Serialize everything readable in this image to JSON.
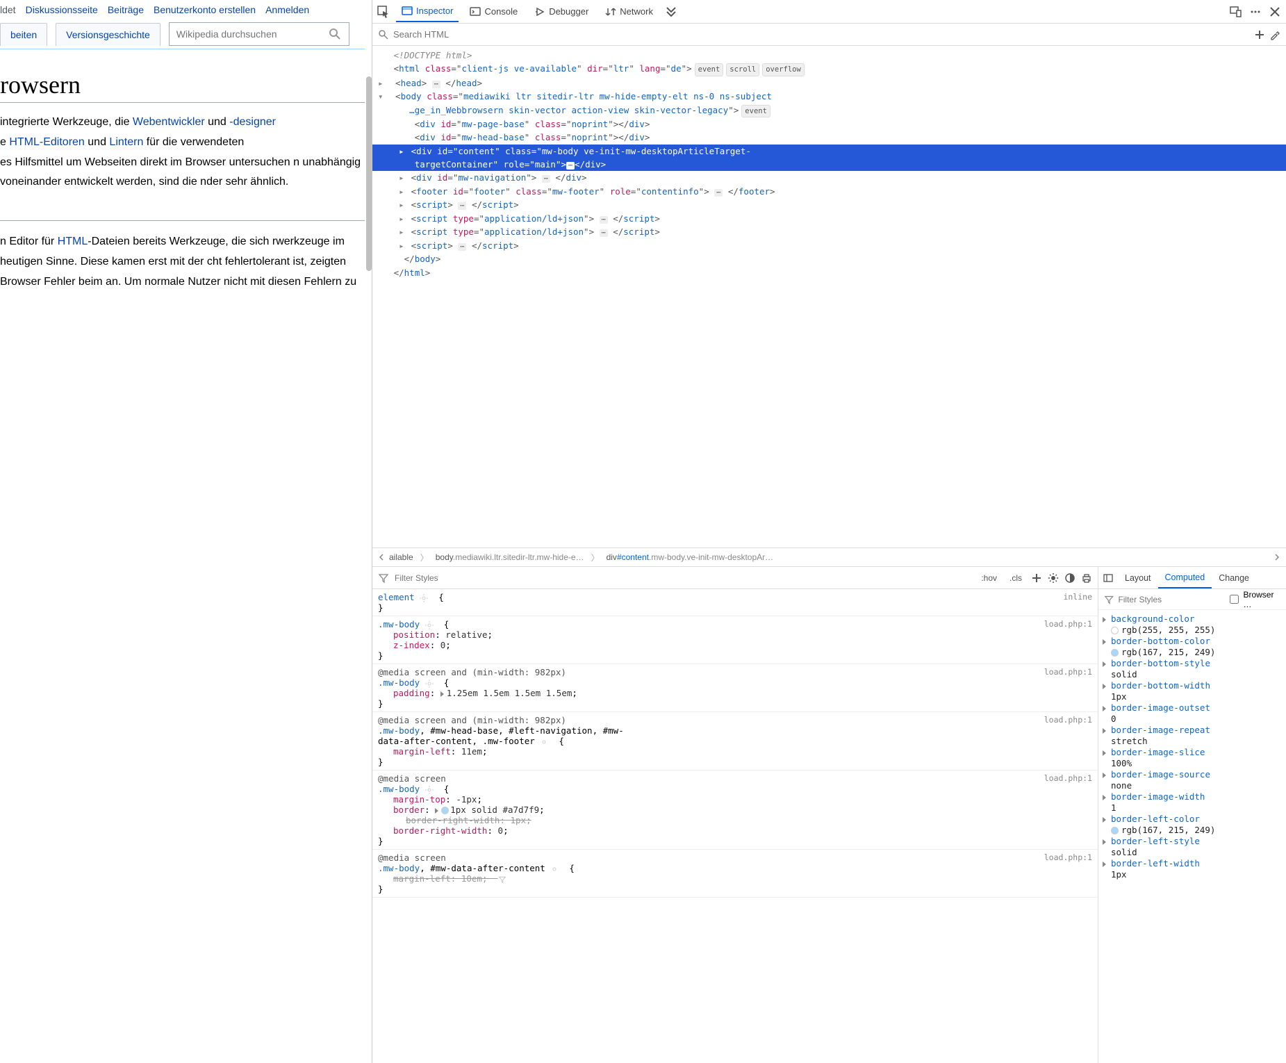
{
  "content": {
    "top_links": [
      "ldet",
      "Diskussionsseite",
      "Beiträge",
      "Benutzerkonto erstellen",
      "Anmelden"
    ],
    "tabs": [
      "beiten",
      "Versionsgeschichte"
    ],
    "search_placeholder": "Wikipedia durchsuchen",
    "heading": "rowsern",
    "para1_pre": " integrierte Werkzeuge, die ",
    "para1_link1": "Webentwickler",
    "para1_mid1": " und ",
    "para1_link2": "-designer",
    "para1_line2a": "e ",
    "para1_link3": "HTML-Editoren",
    "para1_line2b": " und ",
    "para1_link4": "Lintern",
    "para1_line2c": " für die verwendeten",
    "para1_rest": "es Hilfsmittel um Webseiten direkt im Browser untersuchen n unabhängig voneinander entwickelt werden, sind die nder sehr ähnlich.",
    "para2_pre": "n Editor für ",
    "para2_link1": "HTML",
    "para2_rest": "-Dateien bereits Werkzeuge, die sich rwerkzeuge im heutigen Sinne. Diese kamen erst mit der cht fehlertolerant ist, zeigten Browser Fehler beim an. Um normale Nutzer nicht mit diesen Fehlern zu"
  },
  "toolbar": {
    "inspector": "Inspector",
    "console": "Console",
    "debugger": "Debugger",
    "network": "Network"
  },
  "search_html": "Search HTML",
  "dom": {
    "doctype": "<!DOCTYPE html>",
    "html_attrs": "class=\"client-js ve-available\" dir=\"ltr\" lang=\"de\"",
    "html_badges": [
      "event",
      "scroll",
      "overflow"
    ],
    "body_class": "mediawiki ltr sitedir-ltr mw-hide-empty-elt ns-0 ns-subject …ge_in_Webbrowsern skin-vector action-view skin-vector-legacy",
    "body_badge": "event",
    "div_page_base": {
      "id": "mw-page-base",
      "class": "noprint"
    },
    "div_head_base": {
      "id": "mw-head-base",
      "class": "noprint"
    },
    "div_content": {
      "id": "content",
      "class": "mw-body ve-init-mw-desktopArticleTarget-targetContainer",
      "role": "main"
    },
    "div_nav": {
      "id": "mw-navigation"
    },
    "footer": {
      "id": "footer",
      "class": "mw-footer",
      "role": "contentinfo"
    },
    "script_type": "application/ld+json"
  },
  "breadcrumb": {
    "first": "ailable",
    "body": "body",
    "body_cls": ".mediawiki.ltr.sitedir-ltr.mw-hide-e…",
    "div": "div",
    "div_id": "#content",
    "div_cls": ".mw-body.ve-init-mw-desktopAr…"
  },
  "rules": {
    "filter": "Filter Styles",
    "hov": ":hov",
    "cls": ".cls",
    "blocks": [
      {
        "sel": "element",
        "src": "inline",
        "open": "{",
        "decls": [],
        "close": "}"
      },
      {
        "sel": ".mw-body",
        "src": "load.php:1",
        "decls": [
          {
            "p": "position",
            "v": "relative"
          },
          {
            "p": "z-index",
            "v": "0"
          }
        ]
      },
      {
        "media": "@media screen and (min-width: 982px)",
        "src": "load.php:1",
        "sel": ".mw-body",
        "decls": [
          {
            "p": "padding",
            "v": "1.25em 1.5em 1.5em 1.5em",
            "tw": true
          }
        ]
      },
      {
        "media": "@media screen and (min-width: 982px)",
        "src": "load.php:1",
        "sel_multi": ".mw-body, #mw-head-base, #left-navigation, #mw-data-after-content, .mw-footer",
        "decls": [
          {
            "p": "margin-left",
            "v": "11em"
          }
        ]
      },
      {
        "media": "@media screen",
        "src": "load.php:1",
        "sel": ".mw-body",
        "decls": [
          {
            "p": "margin-top",
            "v": "-1px"
          },
          {
            "p": "border",
            "v": "1px solid #a7d7f9",
            "swatch": "#a7d7f9",
            "tw": true
          },
          {
            "p": "border-right-width",
            "v": "1px",
            "override": true,
            "indent": true
          },
          {
            "p": "border-right-width",
            "v": "0"
          }
        ]
      },
      {
        "media": "@media screen",
        "src": "load.php:1",
        "sel_multi2": ".mw-body, #mw-data-after-content",
        "decls": [
          {
            "p": "margin-left",
            "v": "10em",
            "override": true,
            "filter": true
          }
        ]
      }
    ]
  },
  "computed_tabs": [
    "Layout",
    "Computed",
    "Change"
  ],
  "computed_filter": "Filter Styles",
  "browser_label": "Browser …",
  "computed": [
    {
      "n": "background-color",
      "v": "rgb(255, 255, 255)",
      "swatch": "#ffffff"
    },
    {
      "n": "border-bottom-color",
      "v": "rgb(167, 215, 249)",
      "swatch": "#a7d7f9"
    },
    {
      "n": "border-bottom-style",
      "v": "solid"
    },
    {
      "n": "border-bottom-width",
      "v": "1px"
    },
    {
      "n": "border-image-outset",
      "v": "0"
    },
    {
      "n": "border-image-repeat",
      "v": "stretch"
    },
    {
      "n": "border-image-slice",
      "v": "100%"
    },
    {
      "n": "border-image-source",
      "v": "none"
    },
    {
      "n": "border-image-width",
      "v": "1"
    },
    {
      "n": "border-left-color",
      "v": "rgb(167, 215, 249)",
      "swatch": "#a7d7f9"
    },
    {
      "n": "border-left-style",
      "v": "solid"
    },
    {
      "n": "border-left-width",
      "v": "1px"
    }
  ]
}
